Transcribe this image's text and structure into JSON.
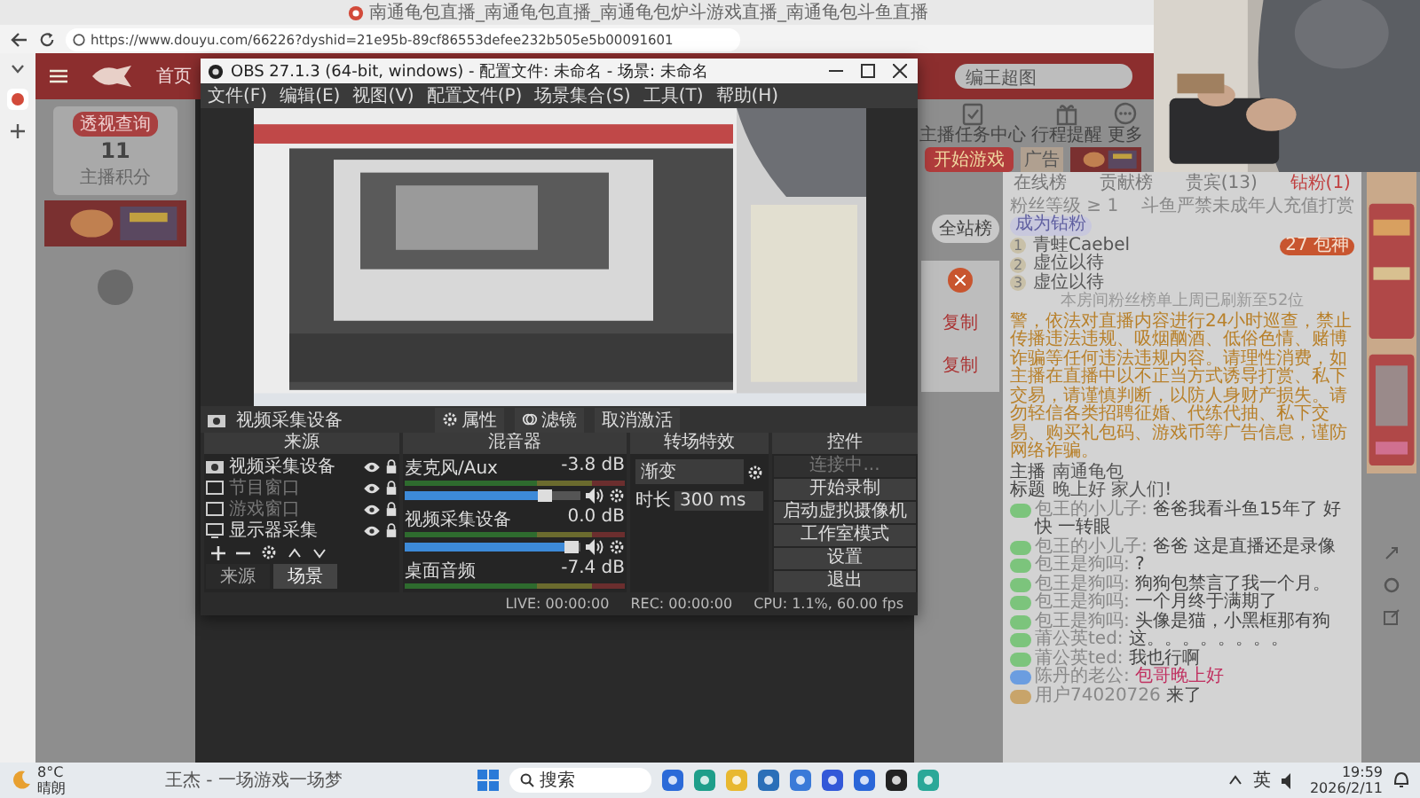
{
  "browser": {
    "tab_title": "南通龟包直播_南通龟包直播_南通龟包炉斗游戏直播_南通龟包斗鱼直播",
    "url": "https://www.douyu.com/66226?dyshid=21e95b-89cf86553defee232b505e5b00091601"
  },
  "site": {
    "nav": "首页",
    "search_hint": "编王超图",
    "points": {
      "badge": "透视查询",
      "value": "11",
      "label": "主播积分"
    },
    "tools": [
      {
        "label": "主播任务中心",
        "kind": "task"
      },
      {
        "label": "行程提醒",
        "kind": "gift"
      },
      {
        "label": "更多",
        "kind": "more"
      }
    ],
    "banner": "开始游戏",
    "ad_badge": "广告",
    "rank_button": "全站榜",
    "copy_buttons": [
      "复制",
      "复制"
    ]
  },
  "obs": {
    "title": "OBS 27.1.3 (64-bit, windows) - 配置文件: 未命名 - 场景: 未命名",
    "menu": [
      "文件(F)",
      "编辑(E)",
      "视图(V)",
      "配置文件(P)",
      "场景集合(S)",
      "工具(T)",
      "帮助(H)"
    ],
    "source_bar": {
      "name": "视频采集设备",
      "buttons": [
        {
          "label": "属性",
          "kind": "gear"
        },
        {
          "label": "滤镜",
          "kind": "filter"
        },
        {
          "label": "取消激活",
          "kind": "plain"
        }
      ]
    },
    "docks": [
      "来源",
      "混音器",
      "转场特效",
      "控件"
    ],
    "sources": [
      {
        "name": "视频采集设备",
        "enabled": true,
        "kind": "camera"
      },
      {
        "name": "节目窗口",
        "enabled": false,
        "kind": "window"
      },
      {
        "name": "游戏窗口",
        "enabled": false,
        "kind": "window"
      },
      {
        "name": "显示器采集",
        "enabled": true,
        "kind": "monitor"
      }
    ],
    "source_tabs": [
      {
        "label": "来源",
        "selected": false
      },
      {
        "label": "场景",
        "selected": true
      }
    ],
    "mixer": [
      {
        "name": "麦克风/Aux",
        "reading": "-3.8 dB",
        "level": 0.8
      },
      {
        "name": "视频采集设备",
        "reading": "0.0 dB",
        "level": 0.95
      },
      {
        "name": "桌面音频",
        "reading": "-7.4 dB"
      }
    ],
    "transition": {
      "name": "渐变",
      "duration_label": "时长",
      "duration": "300 ms"
    },
    "controls": [
      {
        "label": "连接中...",
        "disabled": true
      },
      {
        "label": "开始录制",
        "disabled": false
      },
      {
        "label": "启动虚拟摄像机",
        "disabled": false
      },
      {
        "label": "工作室模式",
        "disabled": false
      },
      {
        "label": "设置",
        "disabled": false
      },
      {
        "label": "退出",
        "disabled": false
      }
    ],
    "status": [
      "LIVE: 00:00:00",
      "REC: 00:00:00",
      "CPU: 1.1%, 60.00 fps"
    ]
  },
  "chat": {
    "tabs": [
      {
        "label": "在线榜",
        "selected": false
      },
      {
        "label": "贡献榜",
        "selected": false
      },
      {
        "label": "贵宾(13)",
        "selected": false
      },
      {
        "label": "钻粉(1)",
        "selected": true
      }
    ],
    "filter": {
      "label": "粉丝等级 ≥ 1",
      "notice": "斗鱼严禁未成年人充值打赏",
      "button": "成为钻粉"
    },
    "ranks": [
      {
        "rank": "1",
        "name": "青蛙Caebel",
        "badge": "27 包神"
      },
      {
        "rank": "2",
        "name": "虚位以待"
      },
      {
        "rank": "3",
        "name": "虚位以待"
      }
    ],
    "rank_note": "本房间粉丝榜单上周已刷新至52位",
    "announcement": "警，依法对直播内容进行24小时巡查，禁止传播违法违规、吸烟酗酒、低俗色情、赌博诈骗等任何违法违规内容。请理性消费，如主播在直播中以不正当方式诱导打赏、私下交易，请谨慎判断，以防人身财产损失。请勿轻信各类招聘征婚、代练代抽、私下交易、购买礼包码、游戏币等广告信息，谨防网络诈骗。",
    "info": [
      {
        "label": "主播",
        "value": "南通龟包"
      },
      {
        "label": "标题",
        "value": "晚上好 家人们!"
      }
    ],
    "messages": [
      {
        "color": "#7cc47c",
        "user": "包王的小儿子:",
        "text": "爸爸我看斗鱼15年了 好快 一转眼"
      },
      {
        "color": "#7cc47c",
        "user": "包王的小儿子:",
        "text": "爸爸 这是直播还是录像"
      },
      {
        "color": "#7cc47c",
        "user": "包王是狗吗:",
        "text": "?"
      },
      {
        "color": "#7cc47c",
        "user": "包王是狗吗:",
        "text": "狗狗包禁言了我一个月。"
      },
      {
        "color": "#7cc47c",
        "user": "包王是狗吗:",
        "text": "一个月终于满期了"
      },
      {
        "color": "#7cc47c",
        "user": "包王是狗吗:",
        "text": "头像是猫，小黑框那有狗"
      },
      {
        "color": "#7cc47c",
        "user": "莆公英ted:",
        "text": "这。。。。。。。。"
      },
      {
        "color": "#7cc47c",
        "user": "莆公英ted:",
        "text": "我也行啊"
      },
      {
        "color": "#6b9de0",
        "user": "陈丹的老公:",
        "text": "包哥晚上好",
        "highlight": true
      },
      {
        "color": "#c8a46a",
        "user": "用户74020726",
        "text": "来了"
      }
    ]
  },
  "taskbar": {
    "temp": "8°C",
    "weather": "晴朗",
    "media": "王杰 - 一场游戏一场梦",
    "search": "搜索",
    "ime": "英",
    "time": "19:59",
    "date": "2026/2/11"
  }
}
